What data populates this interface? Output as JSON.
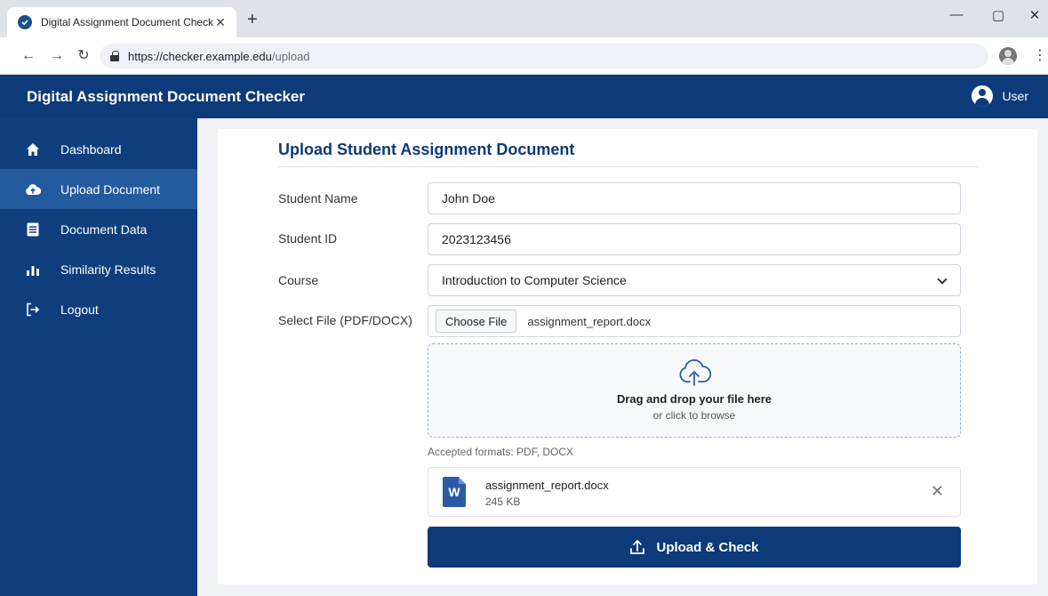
{
  "browser": {
    "tab_title": "Digital Assignment Document Checker",
    "tab_close": "✕",
    "new_tab": "+",
    "url_host": "https://checker.example.edu",
    "url_path": "/upload",
    "minimize": "—",
    "maximize": "▢",
    "close": "✕",
    "back": "←",
    "forward": "→",
    "reload": "↻",
    "menu": "⋮"
  },
  "app": {
    "title": "Digital Assignment Document Checker",
    "user_label": "User"
  },
  "sidebar": {
    "items": [
      {
        "label": "Dashboard",
        "icon": "home-icon"
      },
      {
        "label": "Upload Document",
        "icon": "cloud-upload-icon",
        "active": true
      },
      {
        "label": "Document Data",
        "icon": "document-icon"
      },
      {
        "label": "Similarity Results",
        "icon": "bar-chart-icon"
      },
      {
        "label": "Logout",
        "icon": "logout-icon"
      }
    ]
  },
  "form": {
    "title": "Upload Student Assignment Document",
    "student_name_label": "Student Name",
    "student_name_value": "John Doe",
    "student_id_label": "Student ID",
    "student_id_value": "2023123456",
    "course_label": "Course",
    "course_value": "Introduction to Computer Science",
    "file_label": "Select File (PDF/DOCX)",
    "choose_file_label": "Choose File",
    "chosen_file": "assignment_report.docx",
    "dropzone_main": "Drag and drop your file here",
    "dropzone_sub": "or click to browse",
    "accepted_formats": "Accepted formats: PDF, DOCX",
    "uploaded_file": {
      "name": "assignment_report.docx",
      "size": "245 KB",
      "icon_letter": "W",
      "remove": "✕"
    },
    "submit_label": "Upload & Check"
  },
  "colors": {
    "primary": "#0d3a78",
    "sidebar": "#0f3e7d",
    "sidebar_active": "#245a9e",
    "background": "#f0f2f5"
  }
}
